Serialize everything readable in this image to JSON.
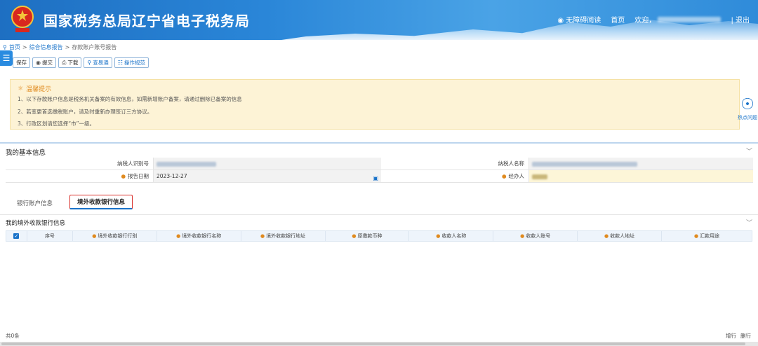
{
  "header": {
    "title": "国家税务总局辽宁省电子税务局",
    "accessibility": "无障碍阅读",
    "home": "首页",
    "welcome": "欢迎，",
    "logout": "| 退出"
  },
  "breadcrumb": {
    "home": "首页",
    "sep": ">",
    "section": "综合信息报告",
    "current": "存款账户账号报告"
  },
  "toolbar": {
    "save": "保存",
    "submit": "提交",
    "download": "下载",
    "lookup": "查易通",
    "guide": "操作规范"
  },
  "tips": {
    "title": "温馨提示",
    "lines": [
      "1、以下存款账户信息是税务机关备案的有效信息，如需新增账户备案，请通过删除已备案的信息",
      "2、若变更首选缴税账户，请及时重新办理签订三方协议。",
      "3、行政区划请您选择“市”一级。"
    ]
  },
  "hotspot": {
    "label": "热点问题"
  },
  "basic_info": {
    "title": "我的基本信息",
    "taxpayer_id_label": "纳税人识别号",
    "taxpayer_name_label": "纳税人名称",
    "report_date_label": "报告日期",
    "report_date": "2023-12-27",
    "handler_label": "经办人"
  },
  "tabs": [
    {
      "label": "银行账户信息"
    },
    {
      "label": "境外收款银行信息"
    }
  ],
  "overseas": {
    "title": "我的境外收款银行信息",
    "columns": [
      "序号",
      "境外收款银行行别",
      "境外收款银行名称",
      "境外收款银行地址",
      "原缴款币种",
      "收款人名称",
      "收款人账号",
      "收款人地址",
      "汇款用途"
    ],
    "count": "共0条",
    "add_row": "增行",
    "delete_row": "删行"
  }
}
